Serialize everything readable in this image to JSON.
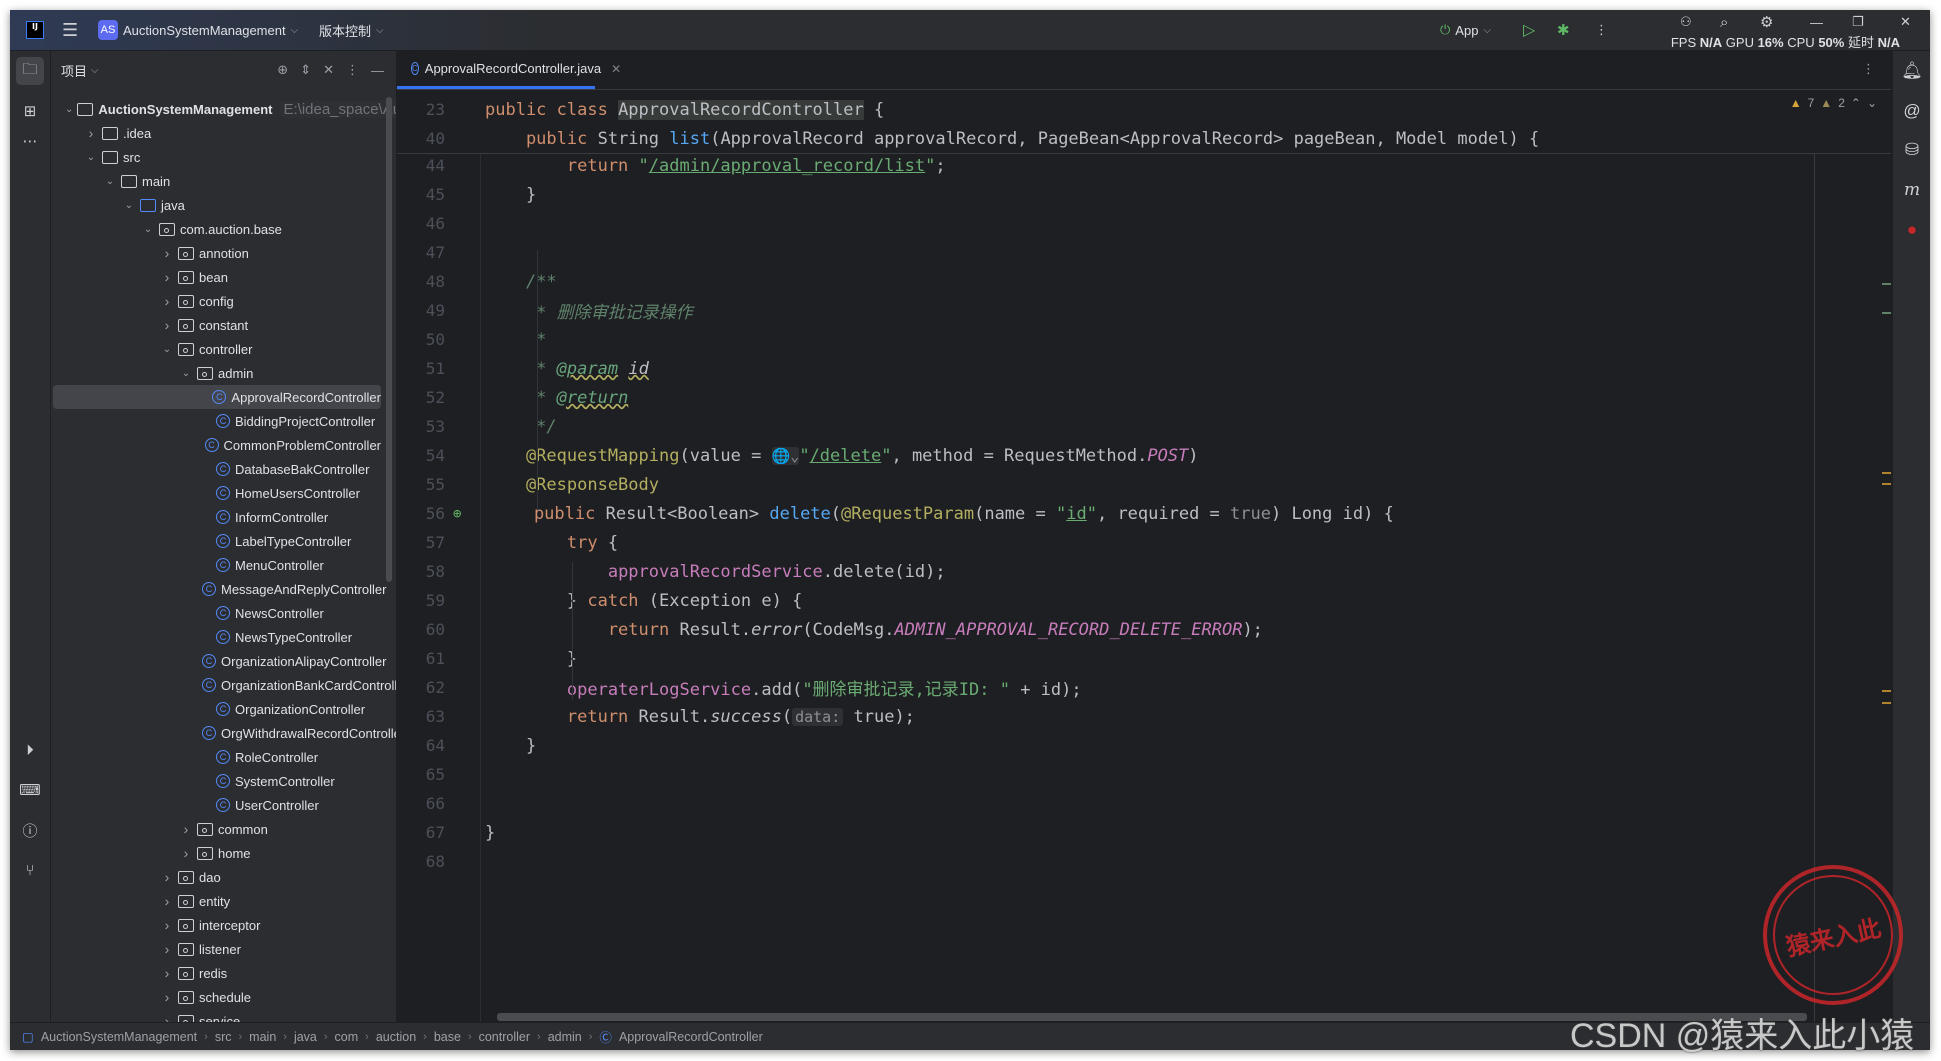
{
  "titlebar": {
    "logo": "IJ",
    "project_badge": "AS",
    "project_name": "AuctionSystemManagement",
    "vcs_label": "版本控制",
    "run_config": "App",
    "stats": {
      "fps_label": "FPS",
      "fps": "N/A",
      "gpu_label": "GPU",
      "gpu": "16%",
      "cpu_label": "CPU",
      "cpu": "50%",
      "latency_label": "延时",
      "latency": "N/A"
    }
  },
  "project_panel": {
    "title": "项目",
    "tree": [
      {
        "label": "AuctionSystemManagement",
        "hint": "E:\\idea_space\\AuctionSystemManagement",
        "depth": 0,
        "type": "project",
        "expanded": true
      },
      {
        "label": ".idea",
        "depth": 1,
        "type": "folder",
        "expanded": false
      },
      {
        "label": "src",
        "depth": 1,
        "type": "folder",
        "expanded": true
      },
      {
        "label": "main",
        "depth": 2,
        "type": "folder",
        "expanded": true
      },
      {
        "label": "java",
        "depth": 3,
        "type": "source-folder",
        "expanded": true
      },
      {
        "label": "com.auction.base",
        "depth": 4,
        "type": "package",
        "expanded": true
      },
      {
        "label": "annotion",
        "depth": 5,
        "type": "package",
        "expanded": false
      },
      {
        "label": "bean",
        "depth": 5,
        "type": "package",
        "expanded": false
      },
      {
        "label": "config",
        "depth": 5,
        "type": "package",
        "expanded": false
      },
      {
        "label": "constant",
        "depth": 5,
        "type": "package",
        "expanded": false
      },
      {
        "label": "controller",
        "depth": 5,
        "type": "package",
        "expanded": true
      },
      {
        "label": "admin",
        "depth": 6,
        "type": "package",
        "expanded": true
      },
      {
        "label": "ApprovalRecordController",
        "depth": 7,
        "type": "class",
        "selected": true
      },
      {
        "label": "BiddingProjectController",
        "depth": 7,
        "type": "class"
      },
      {
        "label": "CommonProblemController",
        "depth": 7,
        "type": "class"
      },
      {
        "label": "DatabaseBakController",
        "depth": 7,
        "type": "class"
      },
      {
        "label": "HomeUsersController",
        "depth": 7,
        "type": "class"
      },
      {
        "label": "InformController",
        "depth": 7,
        "type": "class"
      },
      {
        "label": "LabelTypeController",
        "depth": 7,
        "type": "class"
      },
      {
        "label": "MenuController",
        "depth": 7,
        "type": "class"
      },
      {
        "label": "MessageAndReplyController",
        "depth": 7,
        "type": "class"
      },
      {
        "label": "NewsController",
        "depth": 7,
        "type": "class"
      },
      {
        "label": "NewsTypeController",
        "depth": 7,
        "type": "class"
      },
      {
        "label": "OrganizationAlipayController",
        "depth": 7,
        "type": "class"
      },
      {
        "label": "OrganizationBankCardController",
        "depth": 7,
        "type": "class"
      },
      {
        "label": "OrganizationController",
        "depth": 7,
        "type": "class"
      },
      {
        "label": "OrgWithdrawalRecordController",
        "depth": 7,
        "type": "class"
      },
      {
        "label": "RoleController",
        "depth": 7,
        "type": "class"
      },
      {
        "label": "SystemController",
        "depth": 7,
        "type": "class"
      },
      {
        "label": "UserController",
        "depth": 7,
        "type": "class"
      },
      {
        "label": "common",
        "depth": 6,
        "type": "package",
        "expanded": false
      },
      {
        "label": "home",
        "depth": 6,
        "type": "package",
        "expanded": false
      },
      {
        "label": "dao",
        "depth": 5,
        "type": "package",
        "expanded": false
      },
      {
        "label": "entity",
        "depth": 5,
        "type": "package",
        "expanded": false
      },
      {
        "label": "interceptor",
        "depth": 5,
        "type": "package",
        "expanded": false
      },
      {
        "label": "listener",
        "depth": 5,
        "type": "package",
        "expanded": false
      },
      {
        "label": "redis",
        "depth": 5,
        "type": "package",
        "expanded": false
      },
      {
        "label": "schedule",
        "depth": 5,
        "type": "package",
        "expanded": false
      },
      {
        "label": "service",
        "depth": 5,
        "type": "package",
        "expanded": false
      }
    ]
  },
  "editor": {
    "tab_label": "ApprovalRecordController.java",
    "inspections": {
      "warnings": "7",
      "weak_warnings": "2"
    },
    "sticky_lines": [
      {
        "num": "23",
        "tokens": [
          [
            "public class ",
            "kw"
          ],
          [
            "ApprovalRecordController",
            "hl"
          ],
          [
            " {",
            ""
          ]
        ]
      },
      {
        "num": "40",
        "tokens": [
          [
            "    public ",
            "kw"
          ],
          [
            "String ",
            ""
          ],
          [
            "list",
            "fn"
          ],
          [
            "(ApprovalRecord approvalRecord, PageBean<ApprovalRecord> pageBean, Model model) {",
            ""
          ]
        ]
      }
    ],
    "lines": [
      {
        "num": "44",
        "tokens": [
          [
            "        return ",
            "kw"
          ],
          [
            "\"",
            "str"
          ],
          [
            "/admin/approval_record/list",
            "url"
          ],
          [
            "\"",
            "str"
          ],
          [
            ";",
            ""
          ]
        ]
      },
      {
        "num": "45",
        "tokens": [
          [
            "    }",
            ""
          ]
        ]
      },
      {
        "num": "46",
        "tokens": []
      },
      {
        "num": "47",
        "tokens": []
      },
      {
        "num": "48",
        "tokens": [
          [
            "    /**",
            "doc"
          ]
        ]
      },
      {
        "num": "49",
        "tokens": [
          [
            "     * 删除审批记录操作",
            "doc"
          ]
        ]
      },
      {
        "num": "50",
        "tokens": [
          [
            "     *",
            "doc"
          ]
        ]
      },
      {
        "num": "51",
        "tokens": [
          [
            "     * ",
            "doc"
          ],
          [
            "@param",
            "doctag"
          ],
          [
            " ",
            ""
          ],
          [
            "id",
            "docref"
          ]
        ]
      },
      {
        "num": "52",
        "tokens": [
          [
            "     * ",
            "doc"
          ],
          [
            "@return",
            "doctag"
          ]
        ]
      },
      {
        "num": "53",
        "tokens": [
          [
            "     */",
            "doc"
          ]
        ]
      },
      {
        "num": "54",
        "tokens": [
          [
            "    @RequestMapping",
            "ann"
          ],
          [
            "(value = ",
            ""
          ],
          [
            "🌐⌄",
            "globe"
          ],
          [
            "\"",
            "str"
          ],
          [
            "/delete",
            "url"
          ],
          [
            "\"",
            "str"
          ],
          [
            ", method = RequestMethod.",
            ""
          ],
          [
            "POST",
            "cst"
          ],
          [
            ")",
            ""
          ]
        ]
      },
      {
        "num": "55",
        "tokens": [
          [
            "    @ResponseBody",
            "ann"
          ]
        ]
      },
      {
        "num": "56",
        "tokens": [
          [
            "    public ",
            "kw"
          ],
          [
            "Result<Boolean> ",
            ""
          ],
          [
            "delete",
            "fn"
          ],
          [
            "(",
            ""
          ],
          [
            "@RequestParam",
            "ann"
          ],
          [
            "(name = ",
            ""
          ],
          [
            "\"",
            "str"
          ],
          [
            "id",
            "url"
          ],
          [
            "\"",
            "str"
          ],
          [
            ", required = ",
            ""
          ],
          [
            "true",
            "dim"
          ],
          [
            ") Long id) {",
            ""
          ]
        ],
        "gutter_icon": "web-endpoint"
      },
      {
        "num": "57",
        "tokens": [
          [
            "        try ",
            "kw"
          ],
          [
            "{",
            ""
          ]
        ]
      },
      {
        "num": "58",
        "tokens": [
          [
            "            ",
            ""
          ],
          [
            "approvalRecordService",
            "fld"
          ],
          [
            ".delete(id);",
            ""
          ]
        ]
      },
      {
        "num": "59",
        "tokens": [
          [
            "        } ",
            ""
          ],
          [
            "catch ",
            "kw"
          ],
          [
            "(Exception e) {",
            ""
          ]
        ]
      },
      {
        "num": "60",
        "tokens": [
          [
            "            return ",
            "kw"
          ],
          [
            "Result.",
            ""
          ],
          [
            "error",
            "it"
          ],
          [
            "(CodeMsg.",
            ""
          ],
          [
            "ADMIN_APPROVAL_RECORD_DELETE_ERROR",
            "cst"
          ],
          [
            ");",
            ""
          ]
        ]
      },
      {
        "num": "61",
        "tokens": [
          [
            "        }",
            ""
          ]
        ]
      },
      {
        "num": "62",
        "tokens": [
          [
            "        ",
            ""
          ],
          [
            "operaterLogService",
            "fld"
          ],
          [
            ".add(",
            ""
          ],
          [
            "\"删除审批记录,记录ID: \"",
            "str"
          ],
          [
            " + id);",
            ""
          ]
        ]
      },
      {
        "num": "63",
        "tokens": [
          [
            "        return ",
            "kw"
          ],
          [
            "Result.",
            ""
          ],
          [
            "success",
            "it"
          ],
          [
            "(",
            ""
          ],
          [
            "data:",
            "hint"
          ],
          [
            " true",
            ""
          ],
          [
            ");",
            ""
          ]
        ]
      },
      {
        "num": "64",
        "tokens": [
          [
            "    }",
            ""
          ]
        ]
      },
      {
        "num": "65",
        "tokens": []
      },
      {
        "num": "66",
        "tokens": []
      },
      {
        "num": "67",
        "tokens": [
          [
            "}",
            ""
          ]
        ]
      },
      {
        "num": "68",
        "tokens": []
      }
    ]
  },
  "breadcrumb": [
    "AuctionSystemManagement",
    "src",
    "main",
    "java",
    "com",
    "auction",
    "base",
    "controller",
    "admin",
    "ApprovalRecordController"
  ],
  "watermark": {
    "text": "CSDN @猿来入此小猿",
    "stamp_text": "猿来入此 出品"
  },
  "colors": {
    "accent": "#3574f0",
    "keyword": "#cf8e6d",
    "string": "#6aab73",
    "function": "#56a8f5",
    "field": "#c77dbb",
    "annotation": "#b3ae60",
    "stamp": "#c9262a"
  }
}
